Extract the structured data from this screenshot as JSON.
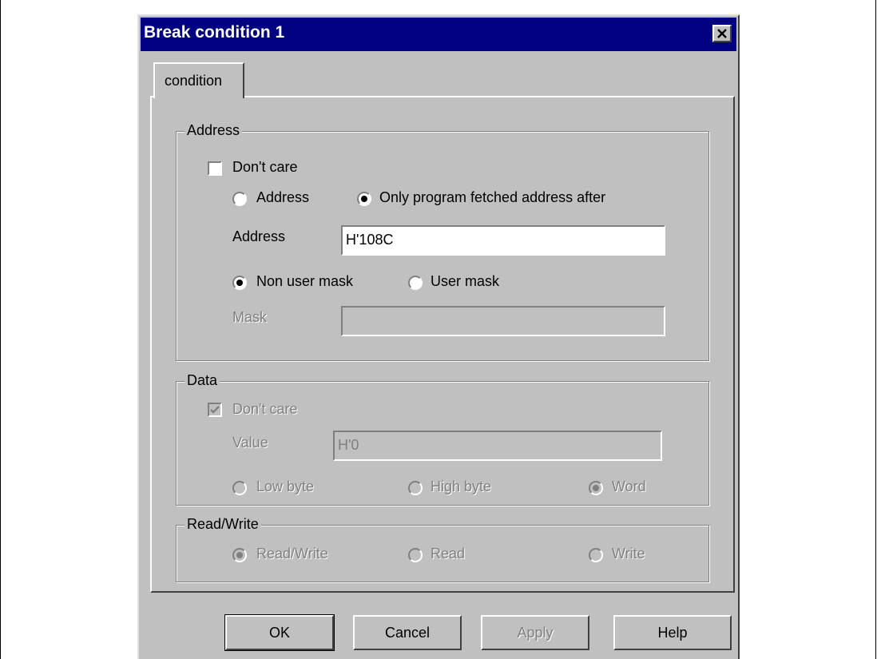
{
  "dialog": {
    "title": "Break condition 1",
    "tab_label": "condition"
  },
  "address_group": {
    "legend": "Address",
    "dont_care": {
      "label": "Don't care",
      "checked": false
    },
    "radio_address_label": "Address",
    "radio_program_fetched_label": "Only program fetched address after",
    "selected_mode": "Only program fetched address after",
    "address_label": "Address",
    "address_value": "H'108C",
    "radio_non_user_mask_label": "Non user mask",
    "radio_user_mask_label": "User mask",
    "selected_mask_mode": "Non user mask",
    "mask_label": "Mask",
    "mask_value": ""
  },
  "data_group": {
    "legend": "Data",
    "dont_care": {
      "label": "Don't care",
      "checked": true
    },
    "value_label": "Value",
    "value_value": "H'0",
    "radio_low_byte_label": "Low byte",
    "radio_high_byte_label": "High byte",
    "radio_word_label": "Word",
    "selected_size": "Word"
  },
  "rw_group": {
    "legend": "Read/Write",
    "radio_read_write_label": "Read/Write",
    "radio_read_label": "Read",
    "radio_write_label": "Write",
    "selected": "Read/Write"
  },
  "buttons": {
    "ok": "OK",
    "cancel": "Cancel",
    "apply": "Apply",
    "help": "Help"
  },
  "colors": {
    "title_bar": "#000080",
    "dialog_face": "#c0c0c0",
    "disabled_text": "#808080"
  }
}
